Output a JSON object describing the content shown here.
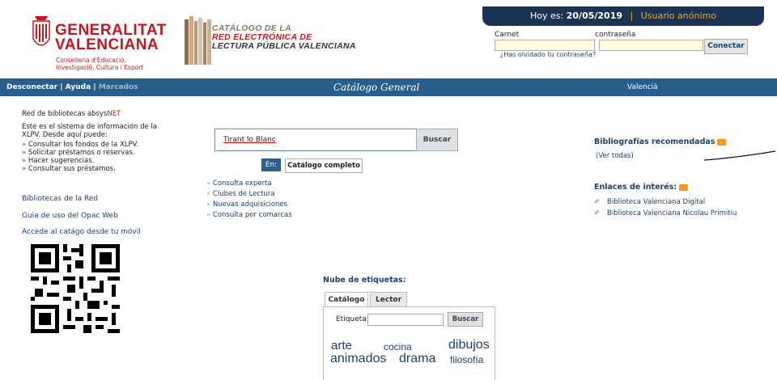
{
  "header": {
    "date_prefix": "Hoy es:",
    "date_value": "20/05/2019",
    "user": "Usuario anónimo",
    "gva_name_line1": "GENERALITAT",
    "gva_name_line2": "VALENCIANA",
    "gva_sub_line1": "Conselleria d'Educació,",
    "gva_sub_line2": "Investigació, Cultura i Esport",
    "catalog_line1": "CATÁLOGO DE LA",
    "catalog_line2": "RED ELECTRÓNICA DE",
    "catalog_line3": "LECTURA PÚBLICA VALENCIANA"
  },
  "login": {
    "carnet_label": "Carnet",
    "password_label": "contraseña",
    "carnet_value": "",
    "password_value": "",
    "button": "Conectar",
    "forgot": "¿Has olvidado tu contraseña?"
  },
  "nav": {
    "disconnect": "Desconectar",
    "separator": "|",
    "help": "Ayuda",
    "bookmarks": "Marcados",
    "center_title": "Catálogo General",
    "language": "Valencià"
  },
  "left": {
    "network_prefix": "Red de bibliotecas ",
    "network_brand_a": "absys",
    "network_brand_b": "NET",
    "intro": "Este es el sistema de información de la XLPV. Desde aquí puede:",
    "items": [
      "Consultar los fondos de la XLPV.",
      "Solicitar préstamos o reservas.",
      "Hacer sugerencias.",
      "Consultar sus préstamos."
    ],
    "link_libraries": "Bibliotecas de la Red",
    "link_guide": "Guía de uso del Opac Web",
    "link_mobile": "Accede al catágo desde tu móvil"
  },
  "search": {
    "query": "Tirant lo Blanc",
    "button": "Buscar",
    "lang_button": "En:",
    "scope_button": "Catálogo completo",
    "links": [
      "Consulta experta",
      "Clubes de Lectura",
      "Nuevas adquisiciones",
      "Consulta por comarcas"
    ]
  },
  "right": {
    "biblio_title": "Bibliografías recomendadas",
    "biblio_link": "(Ver todas)",
    "links_title": "Enlaces de interés:",
    "links": [
      "Biblioteca Valenciana Digital",
      "Biblioteca Valenciana Nicolau Primitiu"
    ]
  },
  "cloud": {
    "title": "Nube de etiquetas:",
    "tab_catalog": "Catálogo",
    "tab_reader": "Lector",
    "label": "Etiqueta:",
    "input_value": "",
    "button": "Buscar",
    "tags": [
      "arte",
      "cocina",
      "dibujos",
      "animados",
      "drama",
      "filosofía"
    ]
  },
  "colors": {
    "brand_red": "#c4161c",
    "nav_blue": "#295d8c",
    "dark_navy": "#1c3253",
    "accent_orange": "#f5a623"
  }
}
